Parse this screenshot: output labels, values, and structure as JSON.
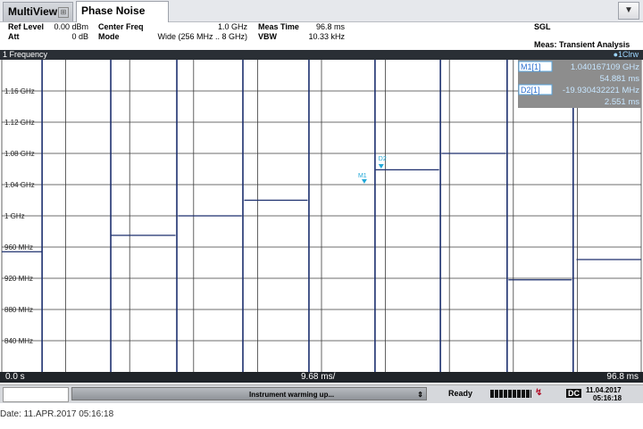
{
  "tabs": {
    "multiview": "MultiView",
    "phase_noise": "Phase Noise",
    "dropdown": "▼"
  },
  "header": {
    "ref_level_label": "Ref Level",
    "ref_level_value": "0.00 dBm",
    "att_label": "Att",
    "att_value": "0 dB",
    "center_freq_label": "Center Freq",
    "center_freq_value": "1.0 GHz",
    "mode_label": "Mode",
    "mode_value": "Wide (256 MHz .. 8 GHz)",
    "meas_time_label": "Meas Time",
    "meas_time_value": "96.8 ms",
    "vbw_label": "VBW",
    "vbw_value": "10.33 kHz",
    "sgl": "SGL",
    "meas_label": "Meas: Transient Analysis"
  },
  "panel": {
    "title": "1 Frequency",
    "trace": "●1Clrw"
  },
  "markers": {
    "m1_label": "M1[1]",
    "m1_freq": "1.040167109 GHz",
    "m1_time": "54.881 ms",
    "d2_label": "D2[1]",
    "d2_freq": "-19.930432221 MHz",
    "d2_time": "2.551 ms",
    "m1_tag": "M1",
    "d2_tag": "D2"
  },
  "axis": {
    "x_start": "0.0 s",
    "x_div": "9.68 ms/",
    "x_end": "96.8 ms"
  },
  "status": {
    "warming": "Instrument warming up...",
    "ready": "Ready",
    "dc": "DC",
    "date": "11.04.2017",
    "time": "05:16:18"
  },
  "footer": {
    "date_line": "Date: 11.APR.2017  05:16:18"
  },
  "colors": {
    "trace": "#1c2f6e",
    "marker": "#22a8d8",
    "grid": "#3c3c3c"
  },
  "chart_data": {
    "type": "line",
    "title": "1 Frequency",
    "xlabel": "",
    "ylabel": "",
    "x_unit": "ms",
    "y_unit": "MHz",
    "xlim": [
      0,
      96.8
    ],
    "ylim": [
      800,
      1200
    ],
    "y_ticks": [
      1160,
      1120,
      1080,
      1040,
      1000,
      960,
      920,
      880,
      840
    ],
    "y_tick_labels": [
      "1.16 GHz",
      "1.12 GHz",
      "1.08 GHz",
      "1.04 GHz",
      "1 GHz",
      "960 MHz",
      "920 MHz",
      "880 MHz",
      "840 MHz"
    ],
    "grid": true,
    "series": [
      {
        "segments": [
          [
            0.0,
            6.1,
            954
          ],
          [
            16.5,
            26.3,
            975
          ],
          [
            26.7,
            36.3,
            1000
          ],
          [
            36.7,
            46.3,
            1020
          ],
          [
            56.6,
            66.2,
            1059
          ],
          [
            66.6,
            76.3,
            1080
          ],
          [
            76.7,
            86.3,
            918
          ],
          [
            87.0,
            96.8,
            944
          ]
        ],
        "edges": [
          6.1,
          16.5,
          26.5,
          36.5,
          46.5,
          56.5,
          66.4,
          76.5,
          86.5
        ]
      }
    ],
    "markers": [
      {
        "name": "M1",
        "x": 54.881,
        "y": 1040.167109
      },
      {
        "name": "D2",
        "x": 57.432,
        "y": 1059.4
      }
    ]
  }
}
